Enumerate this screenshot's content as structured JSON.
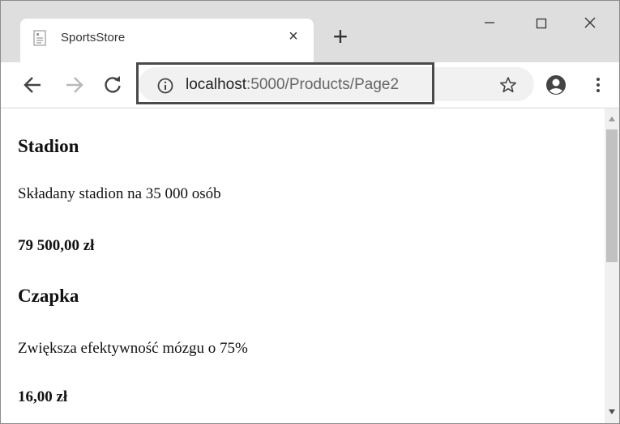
{
  "tab": {
    "title": "SportsStore",
    "close_label": "×",
    "favicon": "page-icon"
  },
  "newtab_label": "+",
  "address": {
    "host": "localhost",
    "path": ":5000/Products/Page2"
  },
  "products": [
    {
      "name": "Stadion",
      "description": "Składany stadion na 35 000 osób",
      "price": "79 500,00 zł"
    },
    {
      "name": "Czapka",
      "description": "Zwiększa efektywność mózgu o 75%",
      "price": "16,00 zł"
    }
  ],
  "colors": {
    "tabstrip": "#dedede",
    "omnibox": "#f1f1f1",
    "highlight_border": "#4a4a4a",
    "scroll_thumb": "#c1c1c1"
  },
  "icons": [
    "page-icon",
    "close-icon",
    "plus-icon",
    "minimize-icon",
    "maximize-icon",
    "window-close-icon",
    "back-arrow-icon",
    "forward-arrow-icon",
    "reload-icon",
    "info-icon",
    "star-icon",
    "account-icon",
    "more-vert-icon",
    "scroll-up-icon",
    "scroll-down-icon"
  ]
}
